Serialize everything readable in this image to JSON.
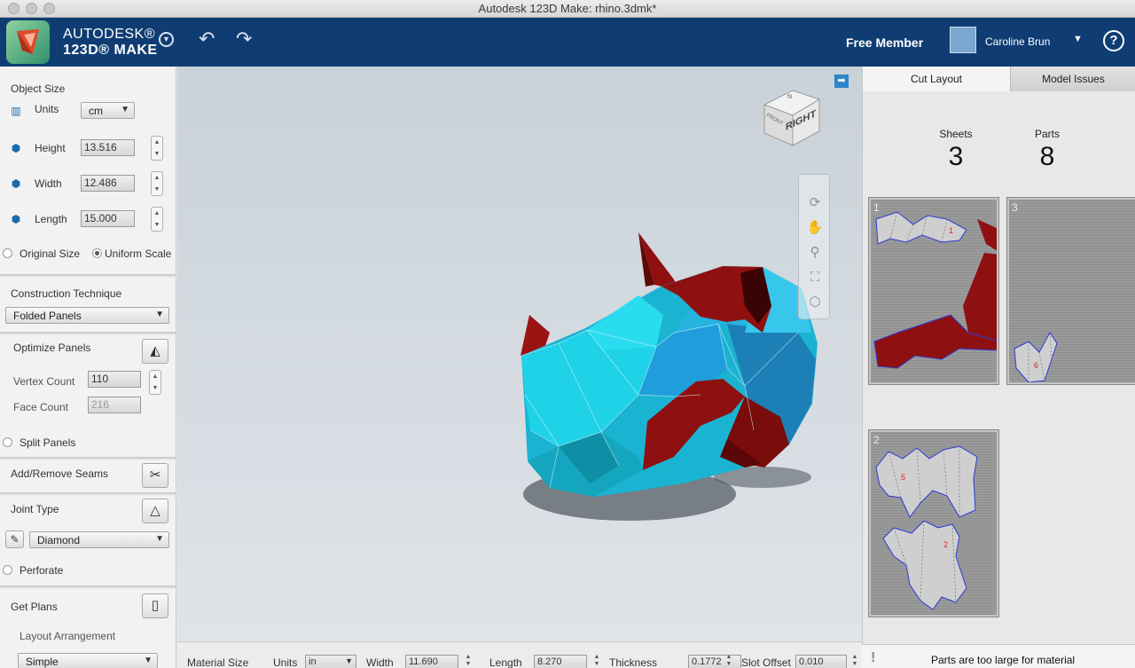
{
  "window": {
    "title": "Autodesk 123D Make: rhino.3dmk*"
  },
  "header": {
    "brand_line1": "AUTODESK®",
    "brand_line2": "123D® MAKE",
    "membership": "Free Member",
    "user_name": "Caroline Brun",
    "help_label": "?"
  },
  "object_size": {
    "title": "Object Size",
    "units_label": "Units",
    "units_value": "cm",
    "height_label": "Height",
    "height_value": "13.516",
    "width_label": "Width",
    "width_value": "12.486",
    "length_label": "Length",
    "length_value": "15.000",
    "original_size_label": "Original Size",
    "uniform_scale_label": "Uniform Scale"
  },
  "construction": {
    "title": "Construction Technique",
    "technique_value": "Folded Panels"
  },
  "optimize": {
    "title": "Optimize Panels",
    "vertex_count_label": "Vertex Count",
    "vertex_count_value": "110",
    "face_count_label": "Face Count",
    "face_count_value": "216",
    "split_panels_label": "Split Panels"
  },
  "seams": {
    "title": "Add/Remove Seams"
  },
  "joint": {
    "title": "Joint Type",
    "type_value": "Diamond",
    "perforate_label": "Perforate"
  },
  "plans": {
    "title": "Get Plans",
    "layout_label": "Layout Arrangement",
    "layout_value": "Simple"
  },
  "viewcube": {
    "face_label": "RIGHT",
    "top_label": "N",
    "front_label": "FRONT"
  },
  "material": {
    "title": "Material Size",
    "units_label": "Units",
    "units_value": "in",
    "width_label": "Width",
    "width_value": "11.690",
    "length_label": "Length",
    "length_value": "8.270",
    "thickness_label": "Thickness",
    "thickness_value": "0.1772",
    "slot_offset_label": "Slot Offset",
    "slot_offset_value": "0.010"
  },
  "right_panel": {
    "tabs": [
      "Cut Layout",
      "Model Issues"
    ],
    "sheets_label": "Sheets",
    "sheets_value": "3",
    "parts_label": "Parts",
    "parts_value": "8",
    "sheet_numbers": [
      "1",
      "3",
      "2"
    ],
    "warning": "Parts are too large for material"
  },
  "colors": {
    "header_bg": "#0f3d73",
    "model_cyan": "#19c2dc",
    "model_blue": "#1e7fb3",
    "model_red": "#8f1010",
    "part_outline": "#2b3bd6"
  }
}
